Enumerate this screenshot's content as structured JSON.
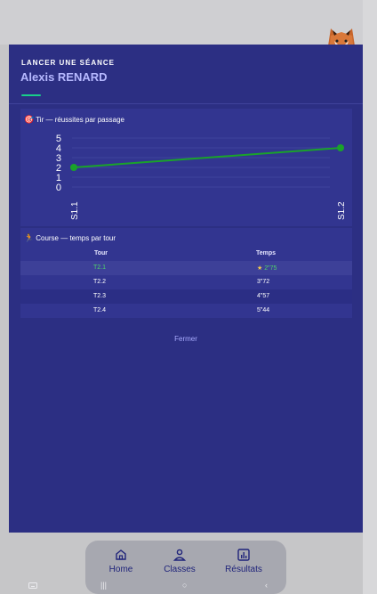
{
  "modal": {
    "kicker": "LANCER UNE SÉANCE",
    "student_name": "Alexis RENARD",
    "close_label": "Fermer"
  },
  "shooting": {
    "emoji": "🎯",
    "title": "Tir — réussites par passage"
  },
  "running": {
    "emoji": "🏃",
    "title": "Course — temps par tour",
    "columns": [
      "Tour",
      "Temps"
    ],
    "rows": [
      {
        "lap": "T2.1",
        "time": "2\"75",
        "best": true
      },
      {
        "lap": "T2.2",
        "time": "3\"72",
        "best": false
      },
      {
        "lap": "T2.3",
        "time": "4\"57",
        "best": false
      },
      {
        "lap": "T2.4",
        "time": "5\"44",
        "best": false
      }
    ],
    "star": "★"
  },
  "chart_data": {
    "type": "line",
    "title": "Tir — réussites par passage",
    "categories": [
      "S1.1",
      "S1.2"
    ],
    "series": [
      {
        "values": [
          2,
          4
        ],
        "color": "#1aa32a"
      }
    ],
    "ylim": [
      0,
      5
    ],
    "yticks": [
      "0",
      "1",
      "2",
      "3",
      "4",
      "5"
    ],
    "grid": true
  },
  "nav": {
    "items": [
      {
        "label": "Home",
        "icon": "home-icon"
      },
      {
        "label": "Classes",
        "icon": "person-icon"
      },
      {
        "label": "Résultats",
        "icon": "bar-chart-icon"
      }
    ]
  },
  "system_bar": {
    "recents": "|||",
    "home": "○",
    "back": "‹"
  },
  "colors": {
    "modal_bg": "#2c2f83",
    "card_bg": "#323590",
    "accent": "#18d08a",
    "name": "#b6b9ff",
    "best": "#4fd46a",
    "line": "#1aa32a"
  }
}
